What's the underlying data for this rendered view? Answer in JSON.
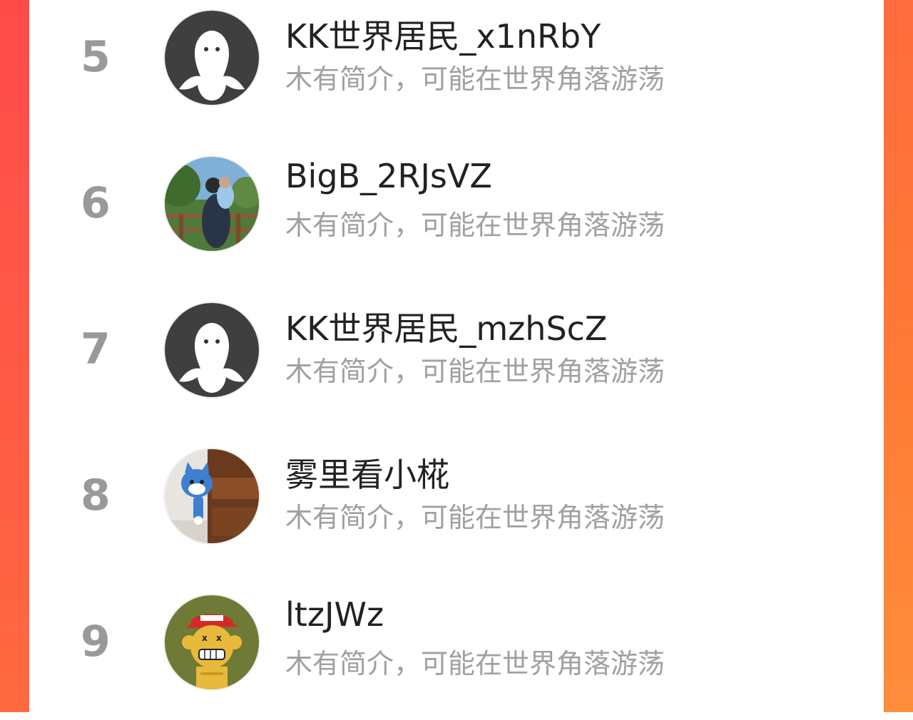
{
  "ranking": {
    "entries": [
      {
        "rank": "5",
        "name": "KK世界居民_x1nRbY",
        "bio": "木有简介，可能在世界角落游荡",
        "avatar": "default-avatar"
      },
      {
        "rank": "6",
        "name": "BigB_2RJsVZ",
        "bio": "木有简介，可能在世界角落游荡",
        "avatar": "photo-avatar"
      },
      {
        "rank": "7",
        "name": "KK世界居民_mzhScZ",
        "bio": "木有简介，可能在世界角落游荡",
        "avatar": "default-avatar"
      },
      {
        "rank": "8",
        "name": "雾里看小椛",
        "bio": "木有简介，可能在世界角落游荡",
        "avatar": "cat-avatar"
      },
      {
        "rank": "9",
        "name": "ltzJWz",
        "bio": "木有简介，可能在世界角落游荡",
        "avatar": "ape-avatar"
      }
    ]
  },
  "colors": {
    "side_left": "#ff4a4a",
    "side_right": "#ff7a36",
    "rank_text": "#999999",
    "name_text": "#222222",
    "bio_text": "#a0a0a0"
  }
}
